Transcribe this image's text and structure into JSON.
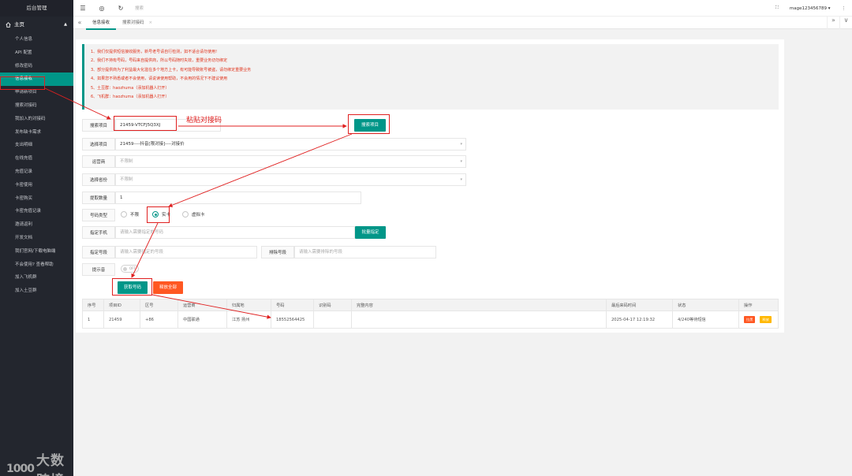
{
  "sidebar": {
    "title": "后台管理",
    "group": "主页",
    "items": [
      "个人信息",
      "API 配置",
      "修改密码",
      "信息接收",
      "申请新项目",
      "搜索对接码",
      "我加入的对接码",
      "发布缺卡需求",
      "支出明细",
      "在线充值",
      "充值记录",
      "卡密使用",
      "卡密购买",
      "卡密充值记录",
      "邀请返利",
      "开发文档",
      "我们官网/下载电脑端",
      "不会使用? 查看帮助",
      "加入飞机群",
      "加入土豆群"
    ],
    "active_index": 3
  },
  "header": {
    "search": "搜索",
    "username": "mage123456789",
    "icons": [
      "menu-icon",
      "home-icon",
      "refresh-icon"
    ]
  },
  "tabs": [
    "信息接收",
    "搜索对接码"
  ],
  "notice": [
    "1、我们仅提供短信接收服务，新号老号请自行检测，如不适合请勿使用!",
    "2、我们不持有号码，号码来自提供商，所以号码随时失效，重要业务切勿绑定",
    "3、部分提供商为了利益最大化滥在多个地方上卡，有可能导致账号被盗，请勿绑定重要业务",
    "4、如果您不熟悉或者不会使用，请说读使用帮助，不会用的情况下不建议使用",
    "5、土豆群：haozhuma（添加机器人打开）",
    "6、飞机群：haozhuma（添加机器人打开）"
  ],
  "form": {
    "search_project_label": "搜索项目",
    "search_project_value": "21459-VTCFJ5Q3XJ",
    "search_button": "搜索项目",
    "select_project_label": "选择项目",
    "select_project_value": "21459----抖音[限对接]----对接价",
    "operator_label": "运营商",
    "operator_value": "不限制",
    "province_label": "选择省份",
    "province_value": "不限制",
    "quantity_label": "提取数量",
    "quantity_value": "1",
    "number_type_label": "号码类型",
    "radio_options": [
      "不限",
      "实卡",
      "虚拟卡"
    ],
    "radio_selected": 1,
    "phone_label": "指定手机",
    "phone_placeholder": "请输入需要指定的号码",
    "batch_button": "批量指定",
    "segment_label": "指定号段",
    "segment_placeholder": "请输入需要指定的号段",
    "exclude_label": "排除号段",
    "exclude_placeholder": "请输入需要排除的号段",
    "tips_label": "提示音",
    "tips_switch": "OFF",
    "get_button": "获取号码",
    "release_button": "释放全部"
  },
  "table": {
    "headers": [
      "序号",
      "项目ID",
      "区号",
      "运营商",
      "归属地",
      "号码",
      "识别码",
      "完整内容",
      "最后来码时间",
      "状态",
      "操作"
    ],
    "rows": [
      {
        "index": "1",
        "project_id": "21459",
        "area_code": "+86",
        "operator": "中国联通",
        "location": "江苏 扬州",
        "number": "18552564425",
        "code": "",
        "content": "",
        "time": "2025-04-17 12:19:32",
        "status": "4/240等待短信",
        "actions": [
          "拉黑",
          "释放"
        ]
      }
    ]
  },
  "annotations": {
    "paste_text": "粘贴对接码"
  },
  "watermark": {
    "logo": "1000",
    "text": "大数跨境"
  },
  "colors": {
    "accent": "#009688",
    "danger": "#ff5722",
    "warn": "#ffb800",
    "annotation": "#e02020",
    "sidebar": "#23262e"
  }
}
